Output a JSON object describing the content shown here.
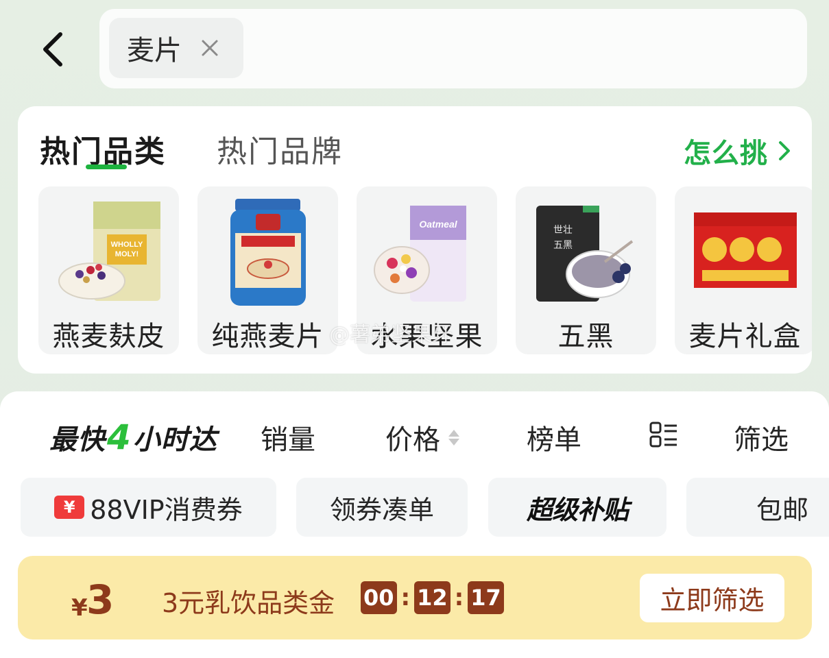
{
  "search": {
    "chip_text": "麦片"
  },
  "categories": {
    "tabs": [
      {
        "label": "热门品类",
        "active": true
      },
      {
        "label": "热门品牌",
        "active": false
      }
    ],
    "how_to_pick": "怎么挑",
    "items": [
      {
        "label": "燕麦麸皮",
        "image": "oat-bran-product"
      },
      {
        "label": "纯燕麦片",
        "image": "pure-oat-jar-product"
      },
      {
        "label": "水果坚果",
        "image": "fruit-nut-oatmeal-product"
      },
      {
        "label": "五黑",
        "image": "five-black-product"
      },
      {
        "label": "麦片礼盒",
        "image": "oat-gift-box-product"
      }
    ]
  },
  "sort": {
    "fast_prefix": "最快",
    "fast_number": "4",
    "fast_suffix": "小时达",
    "sales": "销量",
    "price": "价格",
    "rank": "榜单",
    "filter": "筛选"
  },
  "pills": {
    "vip": "88VIP消费券",
    "coupon": "领券凑单",
    "super": "超级补贴",
    "shipping": "包邮"
  },
  "promo": {
    "yen": "¥",
    "amount": "3",
    "desc": "3元乳饮品类金",
    "timer": [
      "00",
      "12",
      "17"
    ],
    "action": "立即筛选"
  },
  "watermark": "@薯弟坚果牙",
  "colors": {
    "accent_green": "#22b04a",
    "promo_bg": "#fbeaa8",
    "promo_text": "#8d3a1b"
  }
}
